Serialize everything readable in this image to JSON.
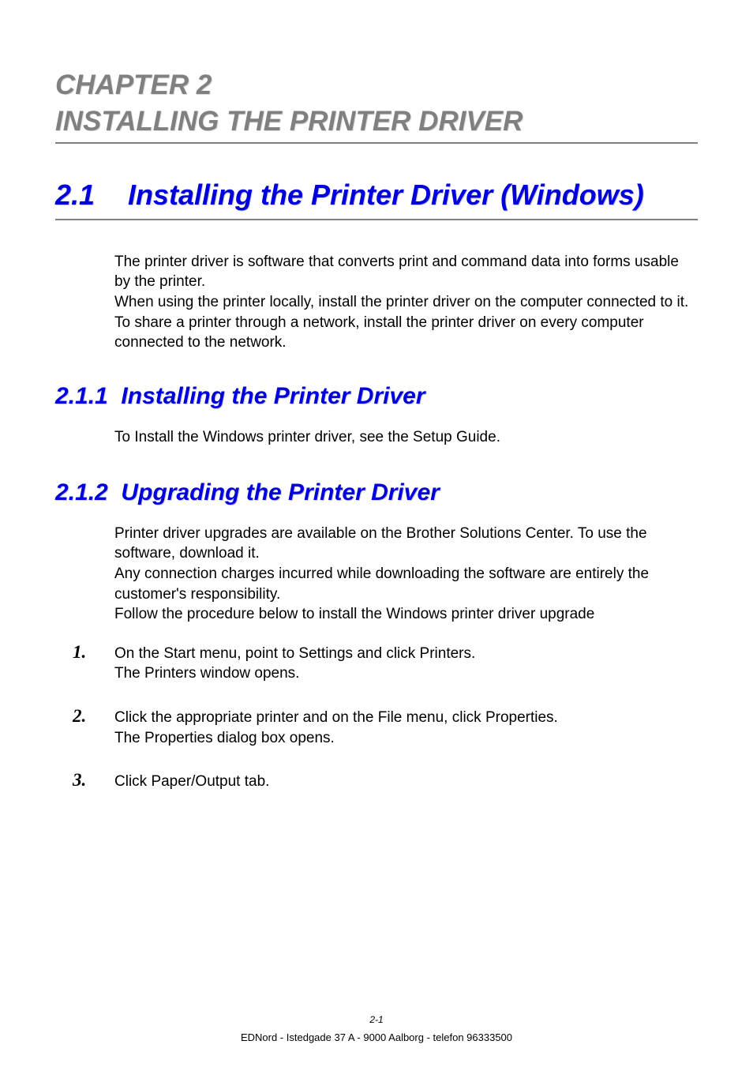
{
  "chapter": {
    "line1": "CHAPTER 2",
    "line2": "INSTALLING THE PRINTER DRIVER"
  },
  "section": {
    "number": "2.1",
    "title": "Installing the Printer Driver (Windows)"
  },
  "intro_paragraph": "The printer driver is software that converts print and command data into forms usable by the printer.\nWhen using the printer locally, install the printer driver on the computer connected to it. To share a printer through a network, install the printer driver on every computer connected to the network.",
  "subsections": [
    {
      "number": "2.1.1",
      "title": "Installing the Printer Driver",
      "body": "To Install the Windows printer driver, see the Setup Guide."
    },
    {
      "number": "2.1.2",
      "title": "Upgrading the Printer Driver",
      "body": "Printer driver upgrades are available on the Brother Solutions Center. To use the software, download it.\nAny connection charges incurred while downloading the software are entirely the customer's responsibility.\nFollow the procedure below to install the Windows printer driver upgrade"
    }
  ],
  "steps": [
    {
      "number": "1.",
      "text": "On the Start menu, point to Settings and click Printers.\nThe Printers window opens."
    },
    {
      "number": "2.",
      "text": "Click the appropriate printer and on the File menu, click Properties.\nThe Properties dialog box opens."
    },
    {
      "number": "3.",
      "text": "Click Paper/Output tab."
    }
  ],
  "footer": {
    "page_number": "2-1",
    "text": "EDNord - Istedgade 37 A - 9000 Aalborg - telefon 96333500"
  }
}
